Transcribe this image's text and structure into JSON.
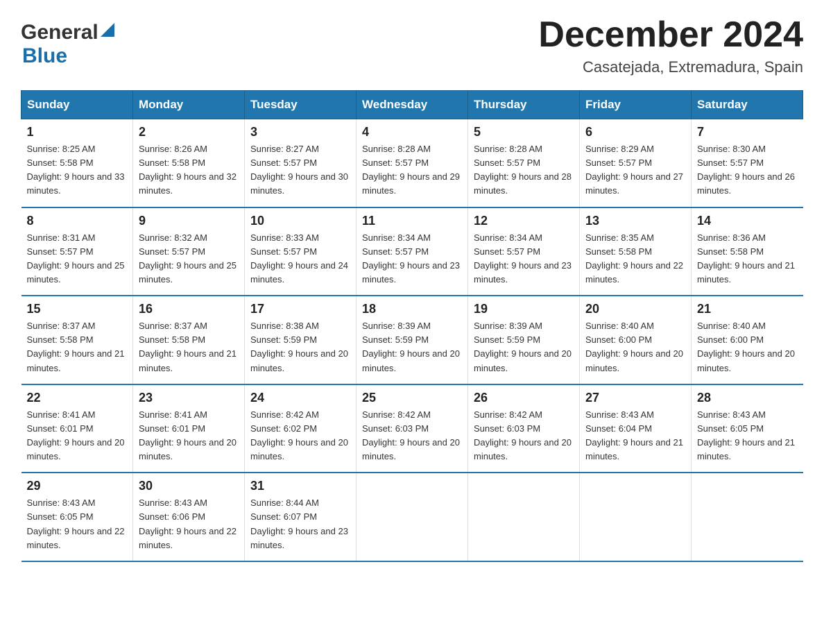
{
  "header": {
    "logo_general": "General",
    "logo_blue": "Blue",
    "title": "December 2024",
    "subtitle": "Casatejada, Extremadura, Spain"
  },
  "days_of_week": [
    "Sunday",
    "Monday",
    "Tuesday",
    "Wednesday",
    "Thursday",
    "Friday",
    "Saturday"
  ],
  "weeks": [
    [
      {
        "day": "1",
        "sunrise": "8:25 AM",
        "sunset": "5:58 PM",
        "daylight": "9 hours and 33 minutes."
      },
      {
        "day": "2",
        "sunrise": "8:26 AM",
        "sunset": "5:58 PM",
        "daylight": "9 hours and 32 minutes."
      },
      {
        "day": "3",
        "sunrise": "8:27 AM",
        "sunset": "5:57 PM",
        "daylight": "9 hours and 30 minutes."
      },
      {
        "day": "4",
        "sunrise": "8:28 AM",
        "sunset": "5:57 PM",
        "daylight": "9 hours and 29 minutes."
      },
      {
        "day": "5",
        "sunrise": "8:28 AM",
        "sunset": "5:57 PM",
        "daylight": "9 hours and 28 minutes."
      },
      {
        "day": "6",
        "sunrise": "8:29 AM",
        "sunset": "5:57 PM",
        "daylight": "9 hours and 27 minutes."
      },
      {
        "day": "7",
        "sunrise": "8:30 AM",
        "sunset": "5:57 PM",
        "daylight": "9 hours and 26 minutes."
      }
    ],
    [
      {
        "day": "8",
        "sunrise": "8:31 AM",
        "sunset": "5:57 PM",
        "daylight": "9 hours and 25 minutes."
      },
      {
        "day": "9",
        "sunrise": "8:32 AM",
        "sunset": "5:57 PM",
        "daylight": "9 hours and 25 minutes."
      },
      {
        "day": "10",
        "sunrise": "8:33 AM",
        "sunset": "5:57 PM",
        "daylight": "9 hours and 24 minutes."
      },
      {
        "day": "11",
        "sunrise": "8:34 AM",
        "sunset": "5:57 PM",
        "daylight": "9 hours and 23 minutes."
      },
      {
        "day": "12",
        "sunrise": "8:34 AM",
        "sunset": "5:57 PM",
        "daylight": "9 hours and 23 minutes."
      },
      {
        "day": "13",
        "sunrise": "8:35 AM",
        "sunset": "5:58 PM",
        "daylight": "9 hours and 22 minutes."
      },
      {
        "day": "14",
        "sunrise": "8:36 AM",
        "sunset": "5:58 PM",
        "daylight": "9 hours and 21 minutes."
      }
    ],
    [
      {
        "day": "15",
        "sunrise": "8:37 AM",
        "sunset": "5:58 PM",
        "daylight": "9 hours and 21 minutes."
      },
      {
        "day": "16",
        "sunrise": "8:37 AM",
        "sunset": "5:58 PM",
        "daylight": "9 hours and 21 minutes."
      },
      {
        "day": "17",
        "sunrise": "8:38 AM",
        "sunset": "5:59 PM",
        "daylight": "9 hours and 20 minutes."
      },
      {
        "day": "18",
        "sunrise": "8:39 AM",
        "sunset": "5:59 PM",
        "daylight": "9 hours and 20 minutes."
      },
      {
        "day": "19",
        "sunrise": "8:39 AM",
        "sunset": "5:59 PM",
        "daylight": "9 hours and 20 minutes."
      },
      {
        "day": "20",
        "sunrise": "8:40 AM",
        "sunset": "6:00 PM",
        "daylight": "9 hours and 20 minutes."
      },
      {
        "day": "21",
        "sunrise": "8:40 AM",
        "sunset": "6:00 PM",
        "daylight": "9 hours and 20 minutes."
      }
    ],
    [
      {
        "day": "22",
        "sunrise": "8:41 AM",
        "sunset": "6:01 PM",
        "daylight": "9 hours and 20 minutes."
      },
      {
        "day": "23",
        "sunrise": "8:41 AM",
        "sunset": "6:01 PM",
        "daylight": "9 hours and 20 minutes."
      },
      {
        "day": "24",
        "sunrise": "8:42 AM",
        "sunset": "6:02 PM",
        "daylight": "9 hours and 20 minutes."
      },
      {
        "day": "25",
        "sunrise": "8:42 AM",
        "sunset": "6:03 PM",
        "daylight": "9 hours and 20 minutes."
      },
      {
        "day": "26",
        "sunrise": "8:42 AM",
        "sunset": "6:03 PM",
        "daylight": "9 hours and 20 minutes."
      },
      {
        "day": "27",
        "sunrise": "8:43 AM",
        "sunset": "6:04 PM",
        "daylight": "9 hours and 21 minutes."
      },
      {
        "day": "28",
        "sunrise": "8:43 AM",
        "sunset": "6:05 PM",
        "daylight": "9 hours and 21 minutes."
      }
    ],
    [
      {
        "day": "29",
        "sunrise": "8:43 AM",
        "sunset": "6:05 PM",
        "daylight": "9 hours and 22 minutes."
      },
      {
        "day": "30",
        "sunrise": "8:43 AM",
        "sunset": "6:06 PM",
        "daylight": "9 hours and 22 minutes."
      },
      {
        "day": "31",
        "sunrise": "8:44 AM",
        "sunset": "6:07 PM",
        "daylight": "9 hours and 23 minutes."
      },
      null,
      null,
      null,
      null
    ]
  ]
}
